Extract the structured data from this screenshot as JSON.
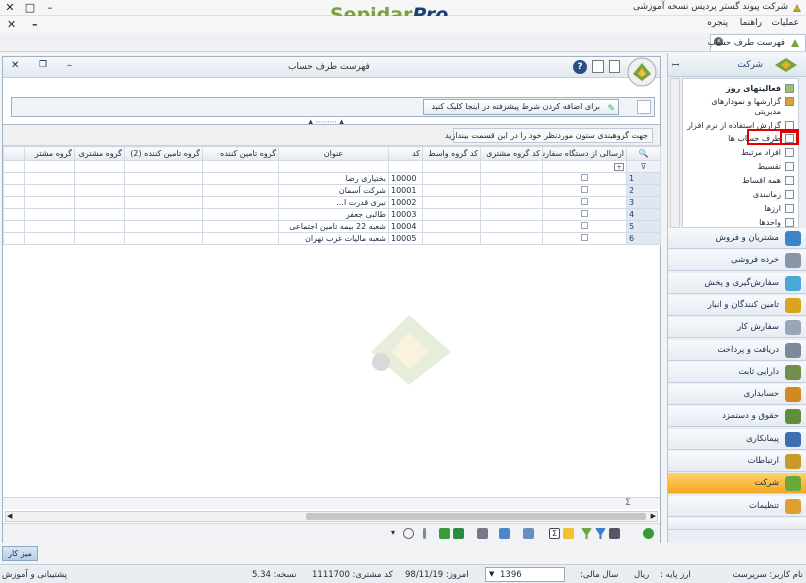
{
  "window": {
    "title": "شرکت پیوند گستر پردیس نسخه آموزشی",
    "brand_part1": "Sepidar",
    "brand_part2": "Pro",
    "min": "–",
    "max": "□",
    "close": "✕"
  },
  "menu": {
    "items": [
      "عملیات",
      "راهنما",
      "پنجره"
    ],
    "close": "✕",
    "minimize": "–"
  },
  "doc_tab": {
    "label": "فهرست طرف حساب"
  },
  "sidebar": {
    "header": "شرکت",
    "tree_items": [
      "فعالیتهای روز",
      "گزارشها و نمودارهای",
      "مدیریتی",
      "گزارش استفاده از نرم افزار",
      "طرف حساب ها",
      "افراد مرتبط",
      "تقسیط",
      "همه اقساط",
      "زمانبندی",
      "ارزها",
      "واحدها"
    ],
    "nav": [
      {
        "label": "مشتریان و فروش",
        "color": "#3a86c8"
      },
      {
        "label": "خرده فروشی",
        "color": "#8a96a8"
      },
      {
        "label": "سفارش‌گیری و پخش",
        "color": "#48a8d8"
      },
      {
        "label": "تامین کنندگان و انبار",
        "color": "#d9a520"
      },
      {
        "label": "سفارش کار",
        "color": "#9aa6b6"
      },
      {
        "label": "دریافت و پرداخت",
        "color": "#7b8a9a"
      },
      {
        "label": "دارایی ثابت",
        "color": "#6f8f4a"
      },
      {
        "label": "حسابداری",
        "color": "#d18a20"
      },
      {
        "label": "حقوق و دستمزد",
        "color": "#5f8f3a"
      },
      {
        "label": "پیمانکاری",
        "color": "#3f6fb0"
      },
      {
        "label": "ارتباطات",
        "color": "#c89a2a"
      },
      {
        "label": "شرکت",
        "color": "#6aa83a"
      },
      {
        "label": "تنظیمات",
        "color": "#e0a030"
      }
    ]
  },
  "panel": {
    "title": "فهرست طرف حساب",
    "filter_button": "برای اضافه کردن شرط پیشرفته در اینجا کلیک کنید",
    "group_hint": "جهت گروهبندی ستون موردنظر خود را در این قسمت بیندازید",
    "columns": [
      "ارسالی از دستگاه سفارش‌گیری",
      "کد گروه مشتری",
      "کد گروه واسط",
      "کد",
      "عنوان",
      "گروه تامین کننده",
      "گروه تامین کننده (2)",
      "گروه مشتری",
      "گروه مشتر"
    ],
    "rows": [
      {
        "n": "1",
        "code": "10000",
        "title": "بختیاری رضا"
      },
      {
        "n": "2",
        "code": "10001",
        "title": "شرکت آسمان"
      },
      {
        "n": "3",
        "code": "10002",
        "title": "نیری قدرت ا..."
      },
      {
        "n": "4",
        "code": "10003",
        "title": "طالبی جعفر"
      },
      {
        "n": "5",
        "code": "10004",
        "title": "شعبه 22  بیمه تامین اجتماعی"
      },
      {
        "n": "6",
        "code": "10005",
        "title": "شعبه مالیات غرب تهران"
      }
    ],
    "sum_symbol": "Σ"
  },
  "taskbar": {
    "tab": "میز کار"
  },
  "status": {
    "user": "نام کاربر: سرپرست",
    "base_currency_label": "ارز پایه :",
    "base_currency": "ریال",
    "fiscal_year_label": "سال مالی:",
    "fiscal_year": "1396",
    "today": "امروز:  98/11/19",
    "customer_code": "کد مشتری:  1111700",
    "version": "نسخه:  5.34",
    "support": "پشتیبانی و آموزش"
  }
}
